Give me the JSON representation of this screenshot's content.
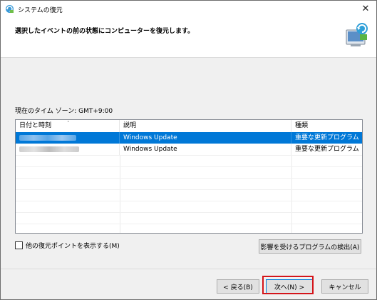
{
  "window": {
    "title": "システムの復元"
  },
  "header": {
    "text": "選択したイベントの前の状態にコンピューターを復元します。"
  },
  "timezone_label": "現在のタイム ゾーン: GMT+9:00",
  "list": {
    "columns": [
      "日付と時刻",
      "説明",
      "種類"
    ],
    "rows": [
      {
        "date": "",
        "description": "Windows Update",
        "type": "重要な更新プログラム",
        "selected": true
      },
      {
        "date": "",
        "description": "Windows Update",
        "type": "重要な更新プログラム",
        "selected": false
      }
    ]
  },
  "show_more_checkbox": {
    "label": "他の復元ポイントを表示する(M)",
    "checked": false
  },
  "buttons": {
    "detect": "影響を受けるプログラムの検出(A)",
    "back": "< 戻る(B)",
    "next": "次へ(N) >",
    "cancel": "キャンセル"
  },
  "colors": {
    "selection": "#0078d7",
    "highlight_ring": "#d4141a"
  }
}
